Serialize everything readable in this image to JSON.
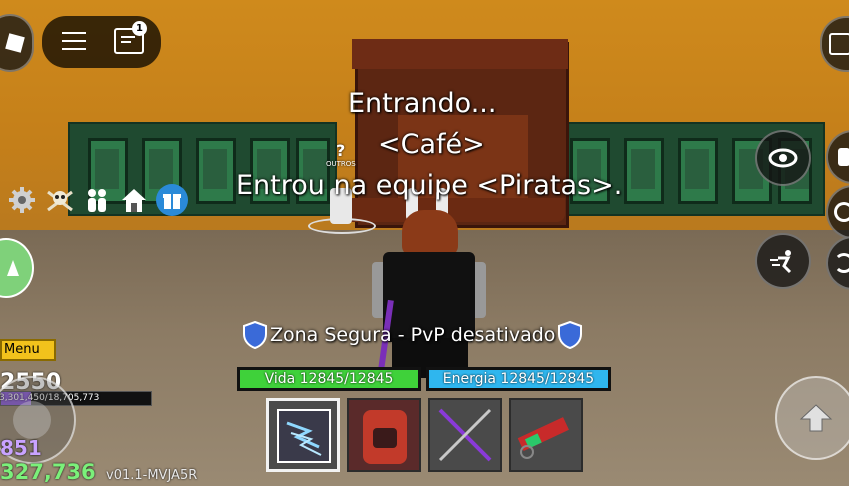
{
  "top_left": {
    "chat_badge": "1"
  },
  "center_messages": {
    "line1": "Entrando...",
    "line2": "<Café>",
    "line3": "Entrou na equipe <Piratas>."
  },
  "npc": {
    "question": "?",
    "tag": "OUTROS"
  },
  "zone": {
    "label": "Zona Segura - PvP desativado"
  },
  "bars": {
    "health": "Vida 12845/12845",
    "energy": "Energia 12845/12845"
  },
  "left_panel": {
    "menu_label": "Menu",
    "level": "2550",
    "xp": "3,301,450/18,705,773",
    "fragments": "851",
    "beli": "327,736"
  },
  "version": "v01.1-MVJA5R",
  "colors": {
    "health": "#3fd13a",
    "energy": "#2fb6ee",
    "wall": "#c9841c",
    "floor": "#8c7b64",
    "menu": "#f2c21c"
  },
  "icons": {
    "left_row": [
      "gear-icon",
      "skull-crossbones-icon",
      "crew-icon",
      "home-icon",
      "gift-icon"
    ],
    "right_column": [
      "eye-icon",
      "dash-icon",
      "jump-icon"
    ],
    "hotbar": [
      "lightning-claw-icon",
      "devil-fruit-icon",
      "dual-sword-icon",
      "gun-icon"
    ]
  }
}
